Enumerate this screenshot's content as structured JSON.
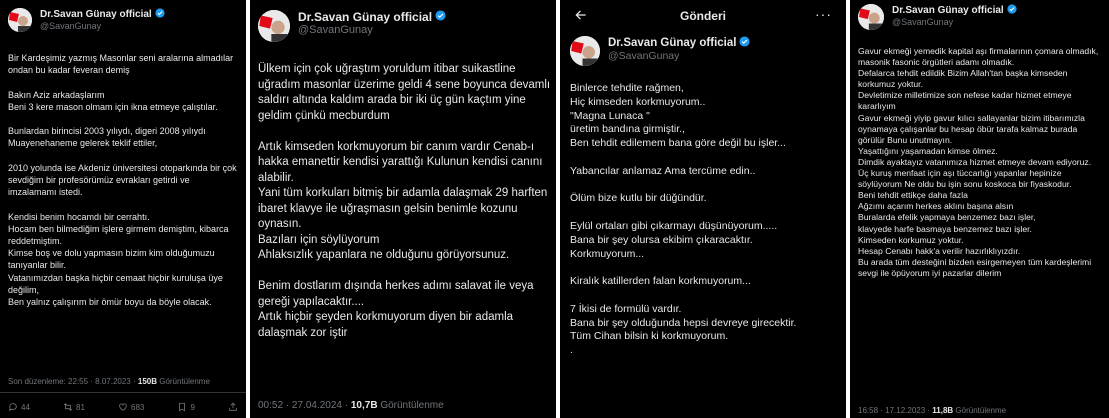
{
  "author": {
    "name": "Dr.Savan Günay official",
    "handle": "@SavanGunay"
  },
  "panel1": {
    "text": "Bir Kardeşimiz yazmış Masonlar seni aralarına almadılar ondan bu kadar feveran demiş\n\nBakın Aziz arkadaşlarım\nBeni 3 kere mason olmam için ikna etmeye çalıştılar.\n\nBunlardan birincisi 2003 yılıydı, digeri 2008 yılıydı Muayeneha­neme gelerek teklif ettiler,\n\n2010 yolunda ise Akdeniz üniversitesi otoparkında bir çok sevdiğim bir profesörümüz evrakları getirdi ve imzalamamı istedi.\n\nKendisi benim hocamdı bir cerrahtı.\nHocam ben bilmediğim işlere girmem demiştim, kibarca reddetmiştim.\nKimse boş ve dolu yapmasın bizim kim olduğumuzu tanıyanlar bilir.\nVatanımızdan başka hiçbir cemaat hiçbir kuruluşa üye değilim,\nBen yalnız çalışırım bir ömür boyu da böyle olacak.",
    "meta_prefix": "Son düzenleme: 22:55 · 8.07.2023 · ",
    "views": "150B",
    "views_label": " Görüntülenme",
    "replies": "44",
    "reposts": "81",
    "likes": "683",
    "bookmarks": "9"
  },
  "panel2": {
    "text": "Ülkem için çok uğraştım yoruldum itibar suikastline uğradım masonlar üzerime geldi 4 sene boyunca devamlı saldırı altında kaldım arada bir iki üç gün kaçtım yine geldim çünkü mecburdum\n\nArtık kimseden korkmuyorum bir canım vardır Cenab-ı hakka emanettir kendisi yarattığı Kulunun kendisi canını alabilir.\nYani tüm korkuları bitmiş bir adamla dalaşmak 29 harften ibaret klavye ile uğraşmasın gelsin benimle kozunu oynasın.\nBazıları için söylüyorum\n Ahlaksızlık yapanlara ne olduğunu görüyorsunuz.\n\nBenim dostlarım dışında herkes adımı salavat ile veya gereği yapılacaktır....\nArtık hiçbir şeyden korkmuyorum diyen bir adamla dalaşmak zor iştir",
    "meta_prefix": "00:52 · 27.04.2024 · ",
    "views": "10,7B",
    "views_label": " Görüntülenme"
  },
  "panel3": {
    "title": "Gönderi",
    "more": "···",
    "text": "Binlerce tehdite rağmen,\nHiç kimseden korkmuyorum..\n\"Magna Lunaca \"\nüretim bandına girmiştir.,\nBen tehdit edilemem bana göre değil bu işler...\n\nYabancılar anlamaz Ama tercüme edin..\n\nÖlüm bize kutlu bir düğündür.\n\nEylül ortaları gibi çıkarmayı düşünüyorum.....\nBana bir şey olursa ekibim çıkaracaktır.\nKorkmuyorum...\n\nKiralık katillerden falan korkmuyorum...\n\n7 İkisi de formülü vardır.\nBana bir şey olduğunda hepsi devreye girecektir.\nTüm Cihan bilsin ki korkmuyorum.\n."
  },
  "panel4": {
    "text": "Gavur ekmeği yemedik kapital aşı firmalarının çomara olmadık, masonik fasonic örgütleri adamı olmadık.\nDefalarca tehdit edildik Bizim Allah'tan başka kimseden korkumuz yoktur.\nDevletimize milletimize son nefese kadar hizmet etmeye kararlıyım\n Gavur ekmeği yiyip gavur kılıcı sallayanlar bizim itibarımızla oynamaya çalışanlar bu hesap öbür tarafa kalmaz burada görülür Bunu unutmayın.\nYaşattığını yaşamadan kimse ölmez.\nDimdik ayaktayız vatanımıza hizmet etmeye devam ediyoruz.\nÜç kuruş menfaat için aşı tüccarlığı yapanlar hepinize söylüyorum Ne oldu bu işin sonu koskoca bir fiyaskodur.\nBeni tehdit ettikçe daha fazla\nAğzımı açarım herkes aklını başına alsın\nBuralarda efelik yapmaya benzemez bazı işler,\nklavyede harfe basmaya benzemez bazı işler.\nKimseden korkumuz yoktur.\nHesap Cenabı hakk'a verilir hazırlıklıyızdır.\nBu arada tüm desteğini bizden esirgemeyen tüm kardeşlerimi sevgi ile öpüyorum iyi pazarlar dilerim",
    "meta_prefix": "16:58 · 17.12.2023 · ",
    "views": "11,8B",
    "views_label": " Görüntülenme"
  },
  "colors": {
    "background": "#000000",
    "text": "#e7e9ea",
    "muted": "#71767b",
    "verified": "#1d9bf0",
    "flag_red": "#e30a17"
  }
}
